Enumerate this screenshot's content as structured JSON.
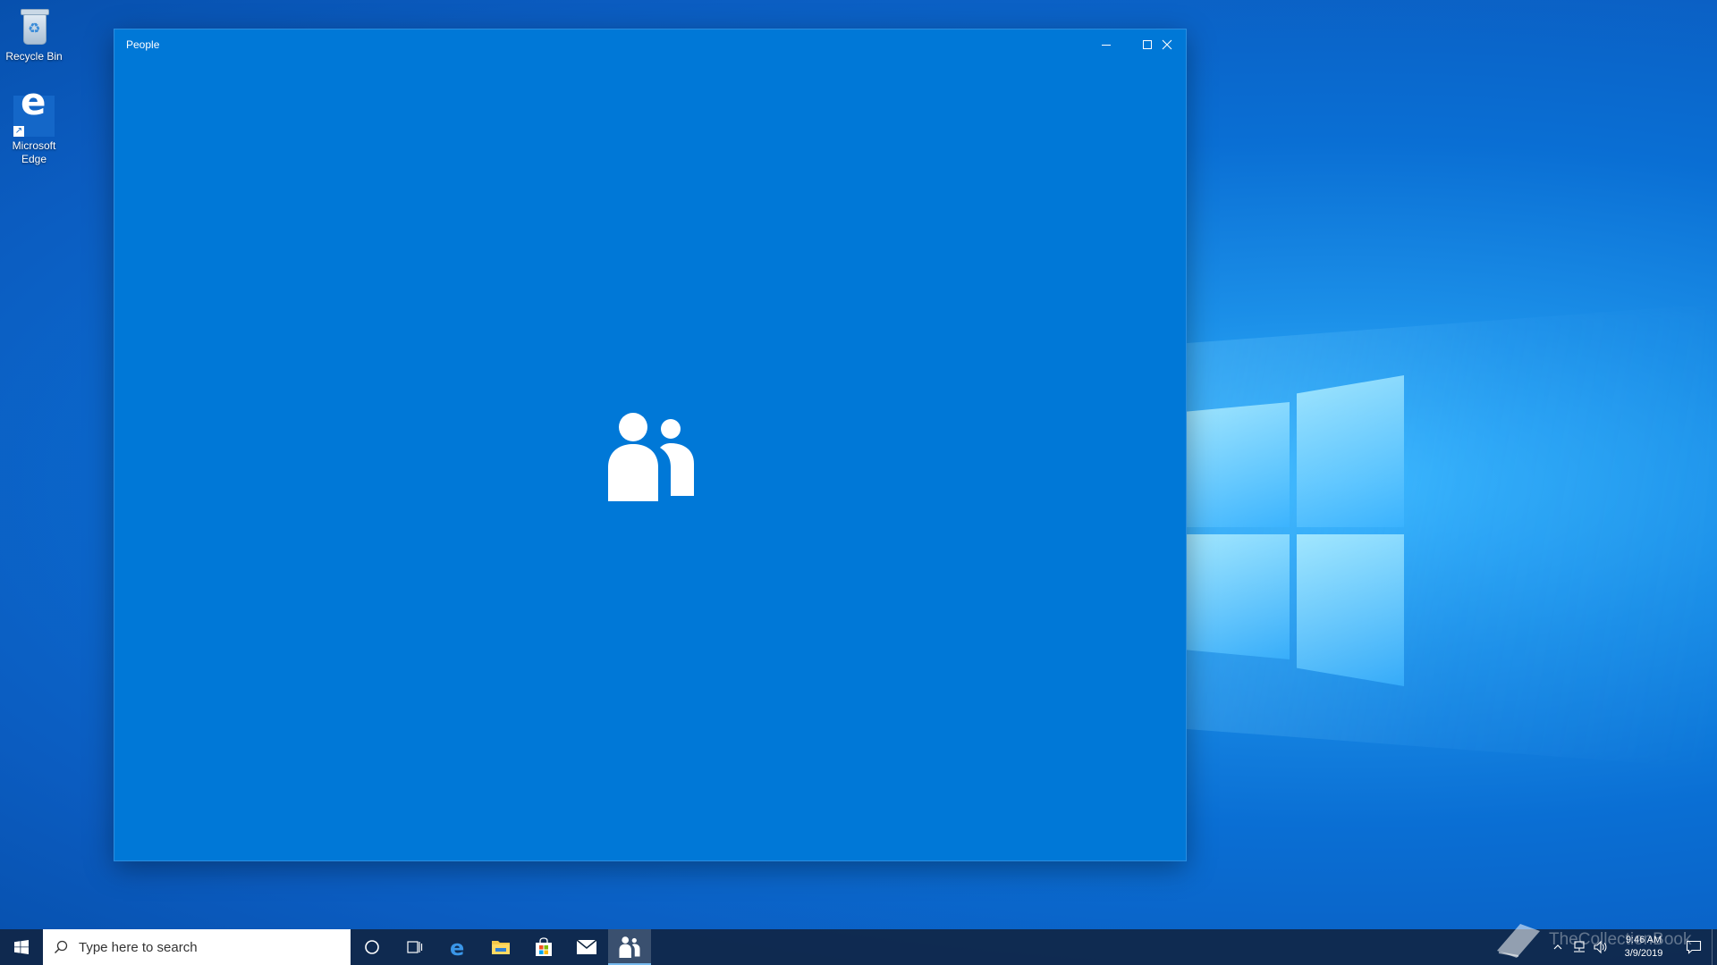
{
  "desktop": {
    "icons": [
      {
        "label": "Recycle Bin",
        "icon": "recycle-bin-icon"
      },
      {
        "label": "Microsoft Edge",
        "icon": "edge-icon"
      }
    ]
  },
  "window": {
    "title": "People",
    "splash_icon": "people-icon",
    "controls": [
      "minimize-icon",
      "maximize-icon",
      "close-icon"
    ]
  },
  "taskbar": {
    "search_placeholder": "Type here to search",
    "apps": [
      {
        "name": "cortana",
        "icon": "cortana-circle-icon"
      },
      {
        "name": "task-view",
        "icon": "task-view-icon"
      },
      {
        "name": "edge",
        "icon": "edge-icon"
      },
      {
        "name": "file-explorer",
        "icon": "folder-icon"
      },
      {
        "name": "store",
        "icon": "store-bag-icon"
      },
      {
        "name": "mail",
        "icon": "mail-icon"
      },
      {
        "name": "people",
        "icon": "people-icon",
        "active": true
      }
    ],
    "tray": {
      "time": "9:46 AM",
      "date": "3/9/2019"
    }
  },
  "watermark": "TheCollectionBook",
  "colors": {
    "window_bg": "#0078d7",
    "taskbar_bg": "#10263f",
    "accent": "#76b9ed"
  }
}
